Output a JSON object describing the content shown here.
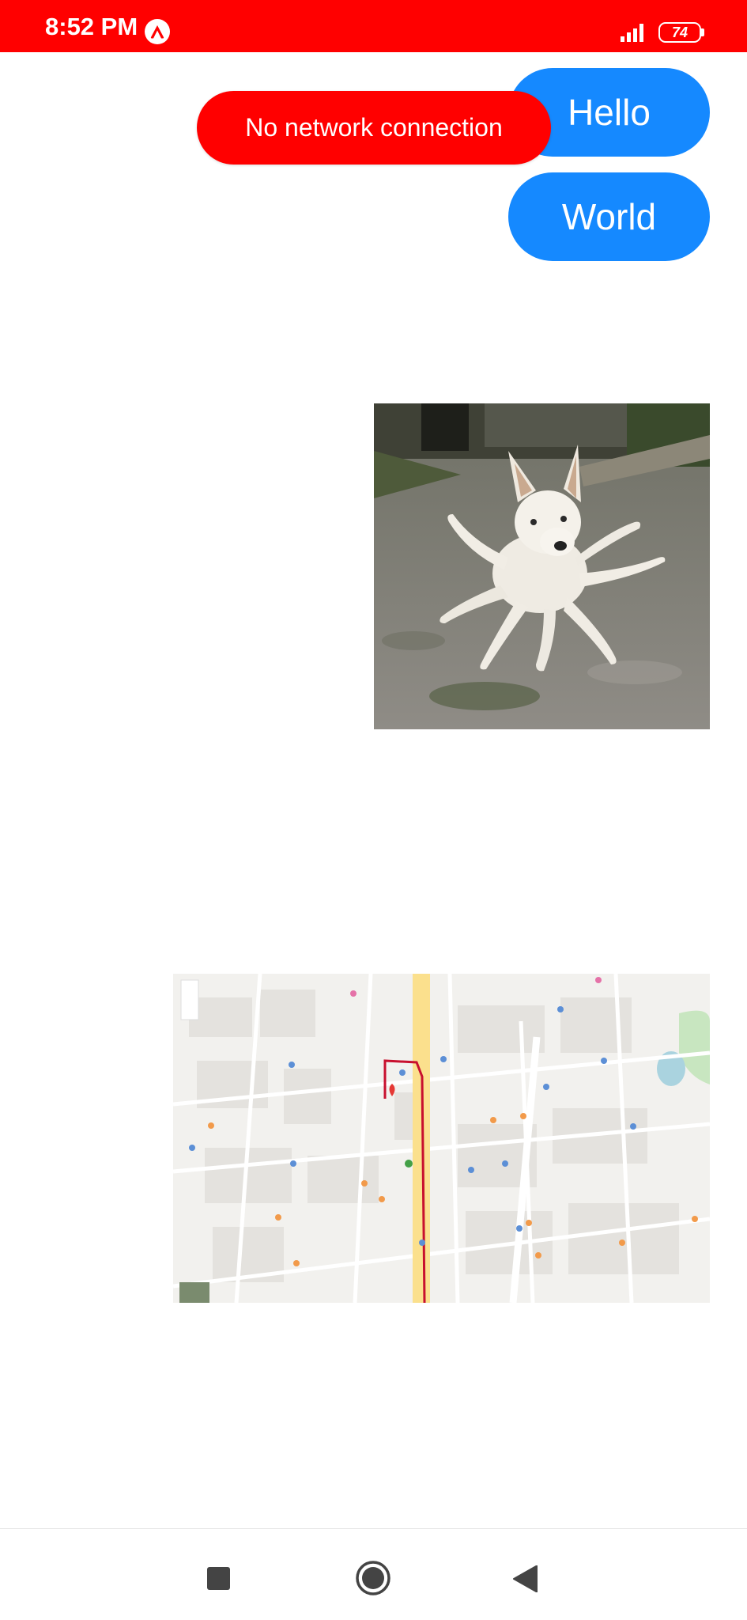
{
  "status_bar": {
    "time": "8:52 PM",
    "battery_level": "74",
    "background_color": "#ff0000",
    "icons": [
      "expo-icon",
      "signal-icon",
      "battery-icon"
    ]
  },
  "messages": [
    {
      "text": "Hello",
      "type": "text"
    },
    {
      "text": "World",
      "type": "text"
    },
    {
      "type": "image",
      "description_icon": "photo-image"
    },
    {
      "type": "map",
      "description_icon": "map-image"
    }
  ],
  "toast": {
    "text": "No network connection",
    "color": "#ff0000"
  },
  "bubble_color": "#1589ff",
  "nav_bar": {
    "buttons": [
      "recents-button",
      "home-button",
      "back-button"
    ]
  }
}
